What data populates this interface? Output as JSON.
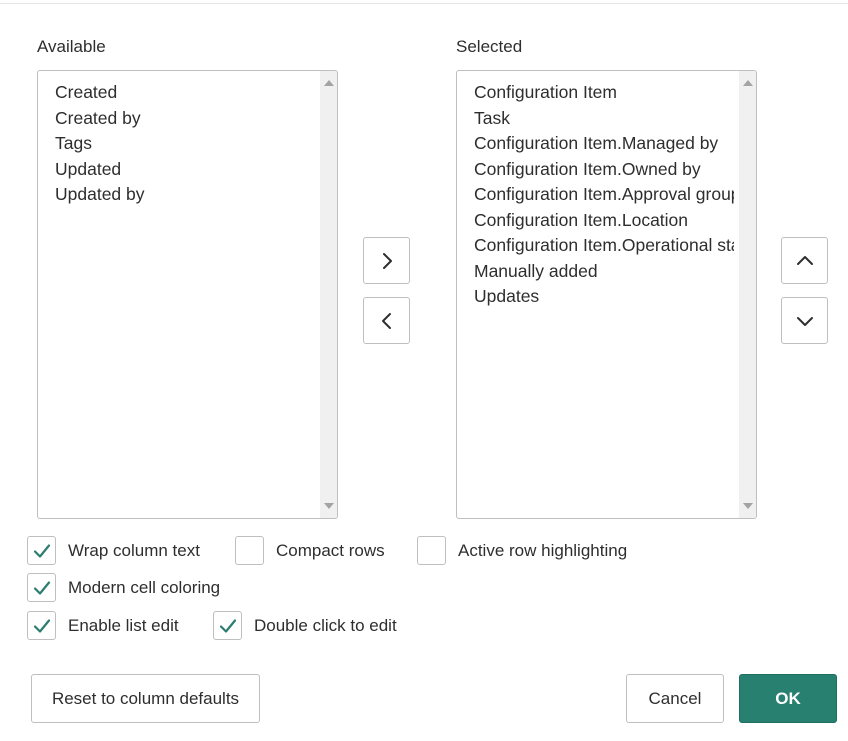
{
  "available": {
    "heading": "Available",
    "items": [
      "Created",
      "Created by",
      "Tags",
      "Updated",
      "Updated by"
    ]
  },
  "selected": {
    "heading": "Selected",
    "items": [
      "Configuration Item",
      "Task",
      "Configuration Item.Managed by",
      "Configuration Item.Owned by",
      "Configuration Item.Approval group",
      "Configuration Item.Location",
      "Configuration Item.Operational status",
      "Manually added",
      "Updates"
    ]
  },
  "icons": {
    "move_right": "chevron-right-icon",
    "move_left": "chevron-left-icon",
    "move_up": "chevron-up-icon",
    "move_down": "chevron-down-icon",
    "check": "checkmark-icon"
  },
  "options": {
    "wrap_column_text": {
      "label": "Wrap column text",
      "checked": true
    },
    "compact_rows": {
      "label": "Compact rows",
      "checked": false
    },
    "active_row_highlighting": {
      "label": "Active row highlighting",
      "checked": false
    },
    "modern_cell_coloring": {
      "label": "Modern cell coloring",
      "checked": true
    },
    "enable_list_edit": {
      "label": "Enable list edit",
      "checked": true
    },
    "double_click_to_edit": {
      "label": "Double click to edit",
      "checked": true
    }
  },
  "buttons": {
    "reset": "Reset to column defaults",
    "cancel": "Cancel",
    "ok": "OK"
  },
  "colors": {
    "accent": "#278070",
    "check": "#2b7d6f",
    "border": "#bfbfbf",
    "text": "#2e2e2e"
  }
}
